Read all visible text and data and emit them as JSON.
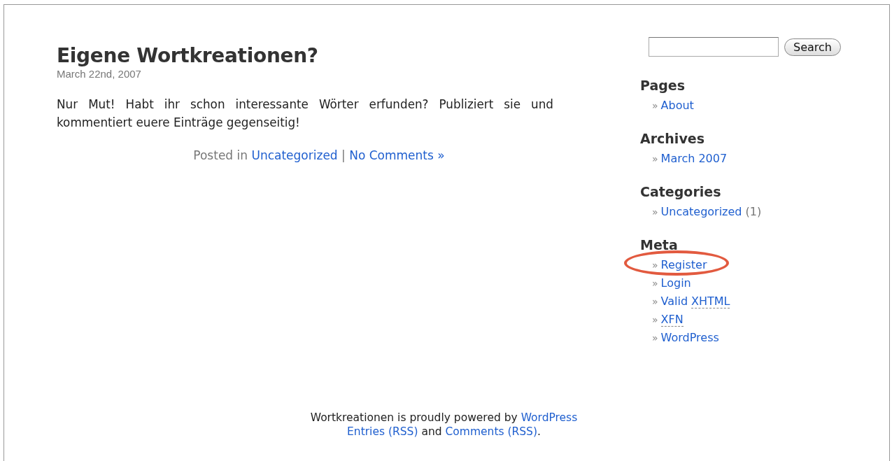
{
  "post": {
    "title": "Eigene Wortkreationen?",
    "date": "March 22nd, 2007",
    "body": "Nur Mut! Habt ihr schon interessante Wörter erfunden? Publiziert sie und kommentiert euere Einträge gegenseitig!",
    "meta": [
      {
        "kind": "plain",
        "text": "Posted in "
      },
      {
        "kind": "link",
        "text": "Uncategorized"
      },
      {
        "kind": "plain",
        "text": " | "
      },
      {
        "kind": "link",
        "text": "No Comments »"
      }
    ]
  },
  "search": {
    "button": "Search"
  },
  "sidebar": [
    {
      "heading": "Pages",
      "items": [
        {
          "bullet": "»",
          "highlighted": false,
          "parts": [
            {
              "kind": "link",
              "text": "About"
            }
          ]
        }
      ]
    },
    {
      "heading": "Archives",
      "items": [
        {
          "bullet": "»",
          "highlighted": false,
          "parts": [
            {
              "kind": "link",
              "text": "March 2007"
            }
          ]
        }
      ]
    },
    {
      "heading": "Categories",
      "items": [
        {
          "bullet": "»",
          "highlighted": false,
          "parts": [
            {
              "kind": "link",
              "text": "Uncategorized"
            },
            {
              "kind": "plain",
              "text": " (1)"
            }
          ]
        }
      ]
    },
    {
      "heading": "Meta",
      "items": [
        {
          "bullet": "»",
          "highlighted": true,
          "parts": [
            {
              "kind": "link",
              "text": "Register"
            }
          ]
        },
        {
          "bullet": "»",
          "highlighted": false,
          "parts": [
            {
              "kind": "link",
              "text": "Login"
            }
          ]
        },
        {
          "bullet": "»",
          "highlighted": false,
          "parts": [
            {
              "kind": "link",
              "text": "Valid"
            },
            {
              "kind": "abbr",
              "text": "XHTML"
            }
          ]
        },
        {
          "bullet": "»",
          "highlighted": false,
          "parts": [
            {
              "kind": "abbr",
              "text": "XFN"
            }
          ]
        },
        {
          "bullet": "»",
          "highlighted": false,
          "parts": [
            {
              "kind": "link",
              "text": "WordPress"
            }
          ]
        }
      ]
    }
  ],
  "footer": [
    [
      {
        "kind": "plain",
        "text": "Wortkreationen is proudly powered by "
      },
      {
        "kind": "link",
        "text": "WordPress"
      }
    ],
    [
      {
        "kind": "link",
        "text": "Entries (RSS)"
      },
      {
        "kind": "plain",
        "text": " and "
      },
      {
        "kind": "link",
        "text": "Comments (RSS)"
      },
      {
        "kind": "plain",
        "text": "."
      }
    ]
  ]
}
